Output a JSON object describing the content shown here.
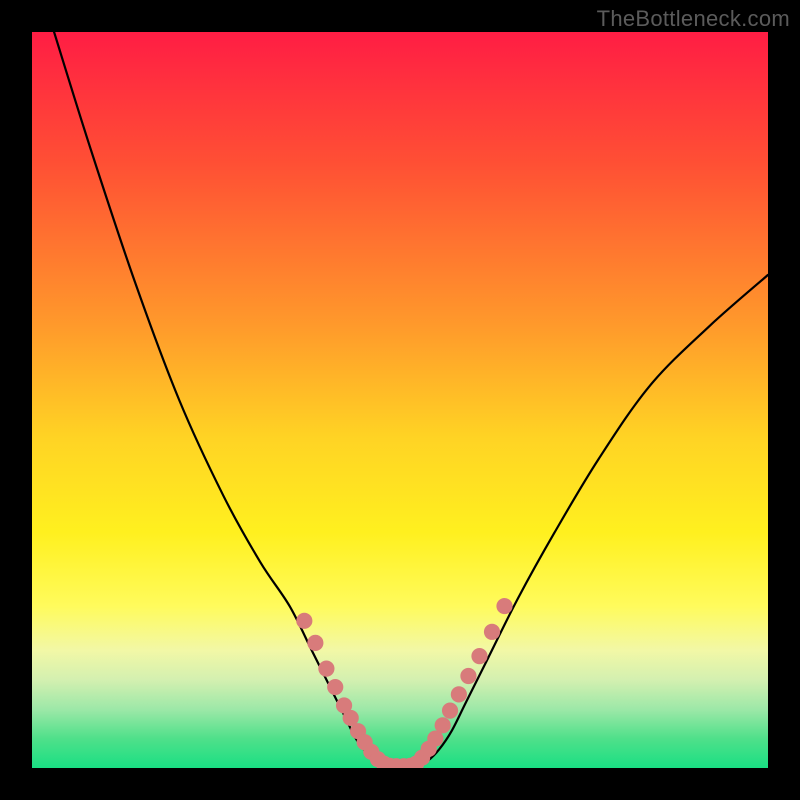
{
  "watermark": "TheBottleneck.com",
  "chart_data": {
    "type": "line",
    "title": "",
    "xlabel": "",
    "ylabel": "",
    "xlim": [
      0,
      100
    ],
    "ylim": [
      0,
      100
    ],
    "background_gradient": [
      "#ff1d44",
      "#ff9a2b",
      "#fff01f",
      "#1adf83"
    ],
    "series": [
      {
        "name": "left-curve",
        "stroke": "#000000",
        "x": [
          3,
          8,
          14,
          20,
          26,
          31,
          35,
          38,
          40.5,
          42.5,
          44,
          45.5,
          46.7,
          47.5
        ],
        "y": [
          100,
          84,
          66,
          50,
          37,
          28,
          22,
          16,
          11,
          7,
          4,
          2,
          0.8,
          0.3
        ]
      },
      {
        "name": "right-curve",
        "stroke": "#000000",
        "x": [
          52.5,
          53.8,
          55.3,
          57,
          59,
          62,
          66,
          71,
          77,
          84,
          92,
          100
        ],
        "y": [
          0.3,
          1,
          2.5,
          5,
          9,
          15,
          23,
          32,
          42,
          52,
          60,
          67
        ]
      },
      {
        "name": "flat-bottom",
        "stroke": "#d87b7b",
        "x": [
          47.5,
          48.5,
          49.5,
          50.5,
          51.5,
          52.5
        ],
        "y": [
          0.3,
          0.25,
          0.22,
          0.22,
          0.25,
          0.3
        ]
      }
    ],
    "markers": [
      {
        "group": "left-cluster",
        "color": "#d87b7b",
        "x": 37.0,
        "y": 20.0,
        "r": 1.1
      },
      {
        "group": "left-cluster",
        "color": "#d87b7b",
        "x": 38.5,
        "y": 17.0,
        "r": 1.1
      },
      {
        "group": "left-cluster",
        "color": "#d87b7b",
        "x": 40.0,
        "y": 13.5,
        "r": 1.1
      },
      {
        "group": "left-cluster",
        "color": "#d87b7b",
        "x": 41.2,
        "y": 11.0,
        "r": 1.1
      },
      {
        "group": "left-cluster",
        "color": "#d87b7b",
        "x": 42.4,
        "y": 8.5,
        "r": 1.1
      },
      {
        "group": "left-cluster",
        "color": "#d87b7b",
        "x": 43.3,
        "y": 6.8,
        "r": 1.1
      },
      {
        "group": "left-cluster",
        "color": "#d87b7b",
        "x": 44.3,
        "y": 5.0,
        "r": 1.1
      },
      {
        "group": "left-cluster",
        "color": "#d87b7b",
        "x": 45.2,
        "y": 3.5,
        "r": 1.1
      },
      {
        "group": "left-cluster",
        "color": "#d87b7b",
        "x": 46.1,
        "y": 2.2,
        "r": 1.1
      },
      {
        "group": "left-cluster",
        "color": "#d87b7b",
        "x": 47.0,
        "y": 1.2,
        "r": 1.1
      },
      {
        "group": "left-cluster",
        "color": "#d87b7b",
        "x": 47.8,
        "y": 0.6,
        "r": 1.1
      },
      {
        "group": "bottom-cluster",
        "color": "#d87b7b",
        "x": 48.6,
        "y": 0.3,
        "r": 1.1
      },
      {
        "group": "bottom-cluster",
        "color": "#d87b7b",
        "x": 49.5,
        "y": 0.25,
        "r": 1.1
      },
      {
        "group": "bottom-cluster",
        "color": "#d87b7b",
        "x": 50.5,
        "y": 0.25,
        "r": 1.1
      },
      {
        "group": "bottom-cluster",
        "color": "#d87b7b",
        "x": 51.4,
        "y": 0.3,
        "r": 1.1
      },
      {
        "group": "right-cluster",
        "color": "#d87b7b",
        "x": 52.2,
        "y": 0.6,
        "r": 1.1
      },
      {
        "group": "right-cluster",
        "color": "#d87b7b",
        "x": 53.0,
        "y": 1.4,
        "r": 1.1
      },
      {
        "group": "right-cluster",
        "color": "#d87b7b",
        "x": 53.9,
        "y": 2.6,
        "r": 1.1
      },
      {
        "group": "right-cluster",
        "color": "#d87b7b",
        "x": 54.8,
        "y": 4.0,
        "r": 1.1
      },
      {
        "group": "right-cluster",
        "color": "#d87b7b",
        "x": 55.8,
        "y": 5.8,
        "r": 1.1
      },
      {
        "group": "right-cluster",
        "color": "#d87b7b",
        "x": 56.8,
        "y": 7.8,
        "r": 1.1
      },
      {
        "group": "right-cluster",
        "color": "#d87b7b",
        "x": 58.0,
        "y": 10.0,
        "r": 1.1
      },
      {
        "group": "right-cluster",
        "color": "#d87b7b",
        "x": 59.3,
        "y": 12.5,
        "r": 1.1
      },
      {
        "group": "right-cluster",
        "color": "#d87b7b",
        "x": 60.8,
        "y": 15.2,
        "r": 1.1
      },
      {
        "group": "right-cluster",
        "color": "#d87b7b",
        "x": 62.5,
        "y": 18.5,
        "r": 1.1
      },
      {
        "group": "right-cluster",
        "color": "#d87b7b",
        "x": 64.2,
        "y": 22.0,
        "r": 1.1
      }
    ]
  }
}
